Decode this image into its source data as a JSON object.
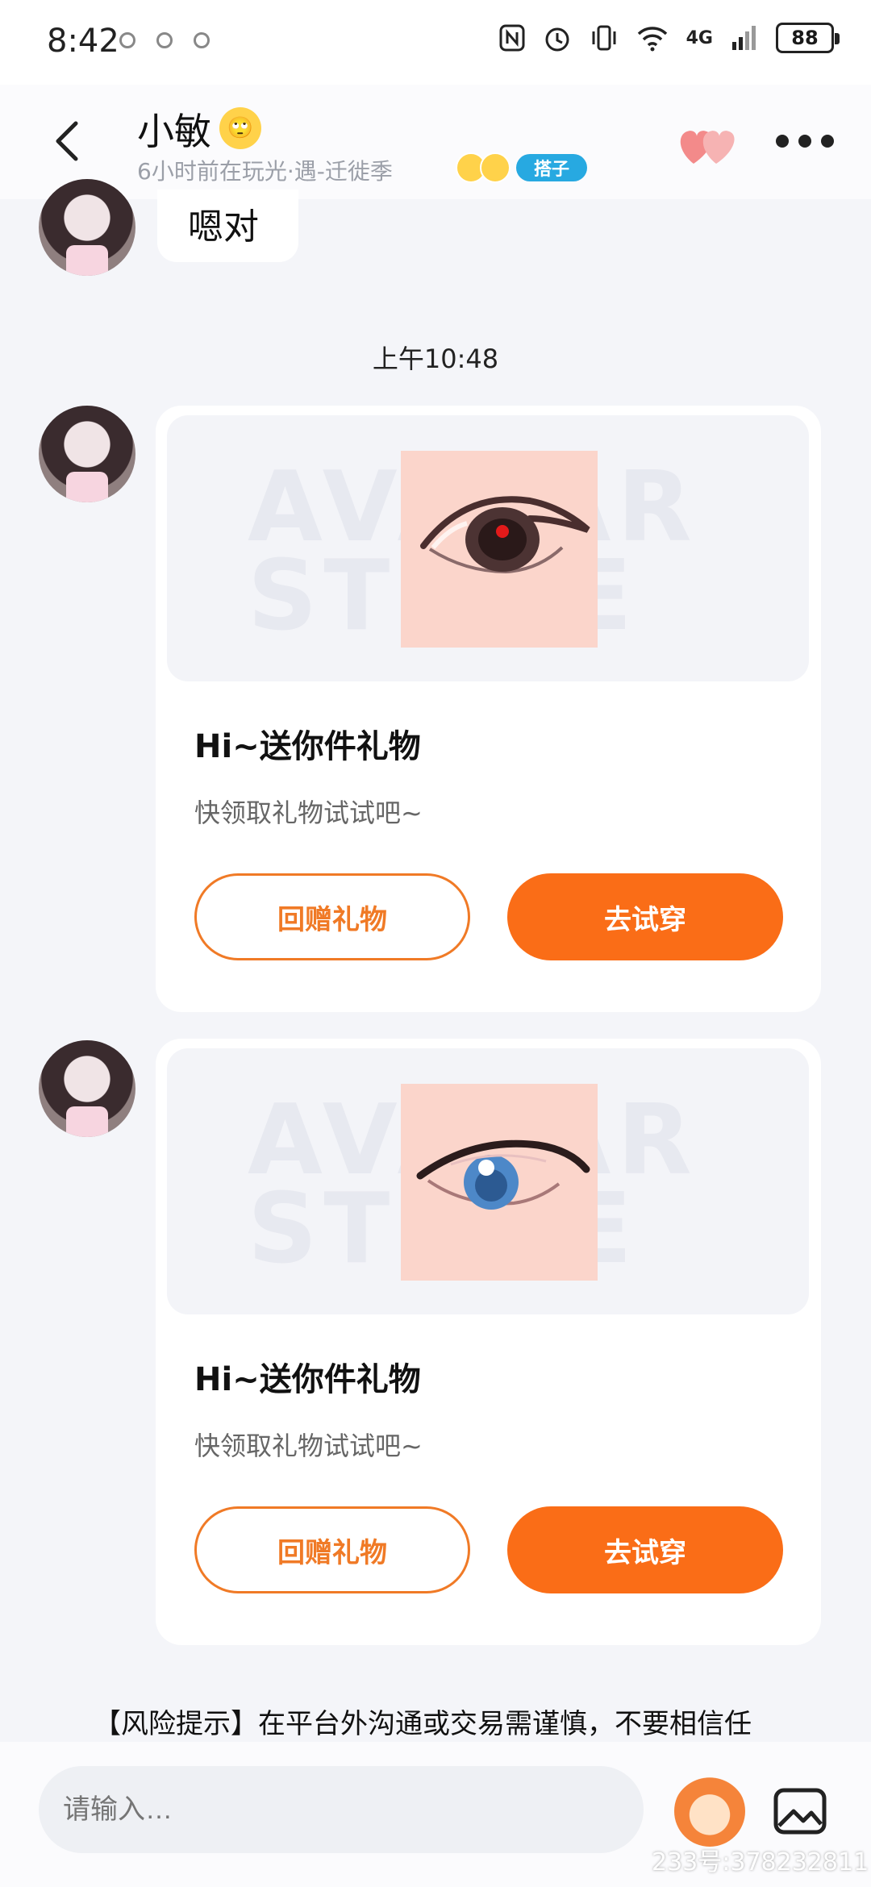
{
  "status_bar": {
    "time": "8:42",
    "network": "4G",
    "battery": "88"
  },
  "header": {
    "name": "小敏",
    "emoji": "🙄",
    "subtitle": "6小时前在玩光·遇-迁徙季",
    "tag": "搭子"
  },
  "messages": [
    {
      "type": "text",
      "text": "嗯对"
    },
    {
      "type": "timestamp",
      "text": "上午10:48"
    },
    {
      "type": "gift",
      "title": "Hi~送你件礼物",
      "subtitle": "快领取礼物试试吧~",
      "watermark": "AVATAR STORE",
      "item_icon": "eye-brown-icon",
      "btn_return": "回赠礼物",
      "btn_try": "去试穿"
    },
    {
      "type": "gift",
      "title": "Hi~送你件礼物",
      "subtitle": "快领取礼物试试吧~",
      "watermark": "AVATAR STORE",
      "item_icon": "eye-blue-icon",
      "btn_return": "回赠礼物",
      "btn_try": "去试穿"
    }
  ],
  "risk_notice": "【风险提示】在平台外沟通或交易需谨慎，不要相信任",
  "input": {
    "placeholder": "请输入…"
  },
  "watermark_id": "233号:378232811",
  "colors": {
    "accent": "#fa6d17",
    "tag": "#27a9e1",
    "bg": "#f4f5f9"
  }
}
